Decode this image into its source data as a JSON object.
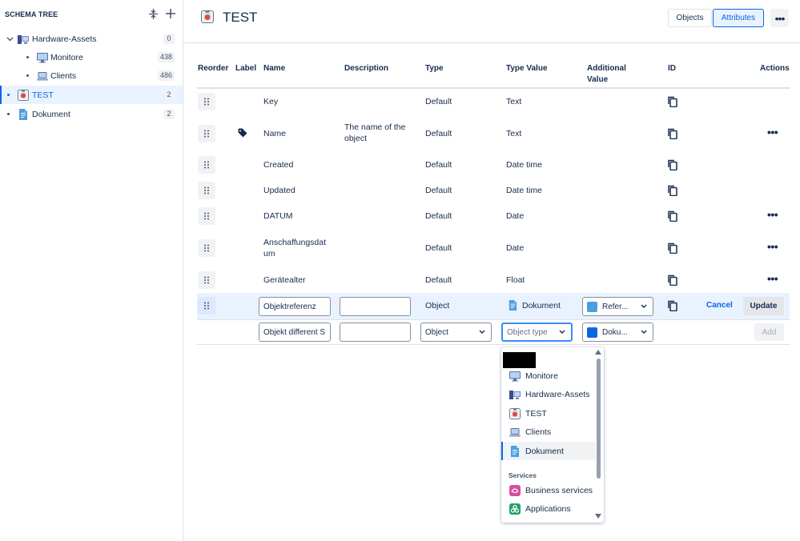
{
  "sidebar": {
    "title": "SCHEMA TREE",
    "items": [
      {
        "label": "Hardware-Assets",
        "count": "0"
      },
      {
        "label": "Monitore",
        "count": "438"
      },
      {
        "label": "Clients",
        "count": "486"
      },
      {
        "label": "TEST",
        "count": "2"
      },
      {
        "label": "Dokument",
        "count": "2"
      }
    ]
  },
  "header": {
    "title": "TEST",
    "tab_objects": "Objects",
    "tab_attributes": "Attributes",
    "more": "•••"
  },
  "table": {
    "headers": {
      "reorder": "Reorder",
      "label": "Label",
      "name": "Name",
      "description": "Description",
      "type": "Type",
      "type_value": "Type Value",
      "additional_value": "Additional Value",
      "id": "ID",
      "actions": "Actions"
    },
    "rows": [
      {
        "name": "Key",
        "description": "",
        "type": "Default",
        "type_value": "Text"
      },
      {
        "name": "Name",
        "description": "The name of the object",
        "type": "Default",
        "type_value": "Text"
      },
      {
        "name": "Created",
        "description": "",
        "type": "Default",
        "type_value": "Date time"
      },
      {
        "name": "Updated",
        "description": "",
        "type": "Default",
        "type_value": "Date time"
      },
      {
        "name": "DATUM",
        "description": "",
        "type": "Default",
        "type_value": "Date"
      },
      {
        "name": "Anschaffungsdatum",
        "description": "",
        "type": "Default",
        "type_value": "Date"
      },
      {
        "name": "Gerätealter",
        "description": "",
        "type": "Default",
        "type_value": "Float"
      }
    ],
    "row_more": "•••",
    "edit_row": {
      "name_value": "Objektreferenz",
      "description_value": "",
      "type": "Object",
      "type_value": "Dokument",
      "additional_value": "Refer...",
      "additional_color": "#4a9fe0",
      "cancel": "Cancel",
      "update": "Update"
    },
    "new_row": {
      "name_value": "Objekt different S",
      "description_value": "",
      "type_select": "Object",
      "type_value_placeholder": "Object type",
      "additional_value": "Doku...",
      "additional_color": "#0c66e4",
      "add": "Add"
    }
  },
  "dropdown": {
    "items": [
      "Monitore",
      "Hardware-Assets",
      "TEST",
      "Clients",
      "Dokument"
    ],
    "group_label": "Services",
    "service_items": [
      "Business services",
      "Applications"
    ]
  }
}
